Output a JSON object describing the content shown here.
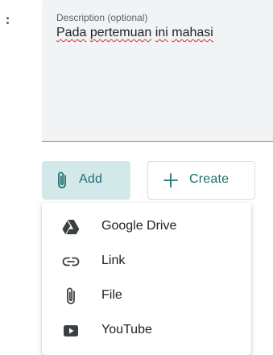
{
  "description": {
    "label": "Description (optional)",
    "value_words": [
      "Pada",
      "pertemuan",
      "ini",
      "mahasi"
    ]
  },
  "add_button": {
    "label": "Add",
    "icon": "paperclip-icon"
  },
  "create_button": {
    "label": "Create",
    "icon": "plus-icon"
  },
  "menu": {
    "items": [
      {
        "label": "Google Drive",
        "icon": "google-drive-icon"
      },
      {
        "label": "Link",
        "icon": "link-icon"
      },
      {
        "label": "File",
        "icon": "paperclip-icon"
      },
      {
        "label": "YouTube",
        "icon": "youtube-icon"
      }
    ]
  },
  "colors": {
    "accent": "#1e6f72",
    "add_button_bg": "#d3e8e9",
    "field_bg": "#f1f3f4",
    "spellcheck_underline": "#d93025"
  }
}
